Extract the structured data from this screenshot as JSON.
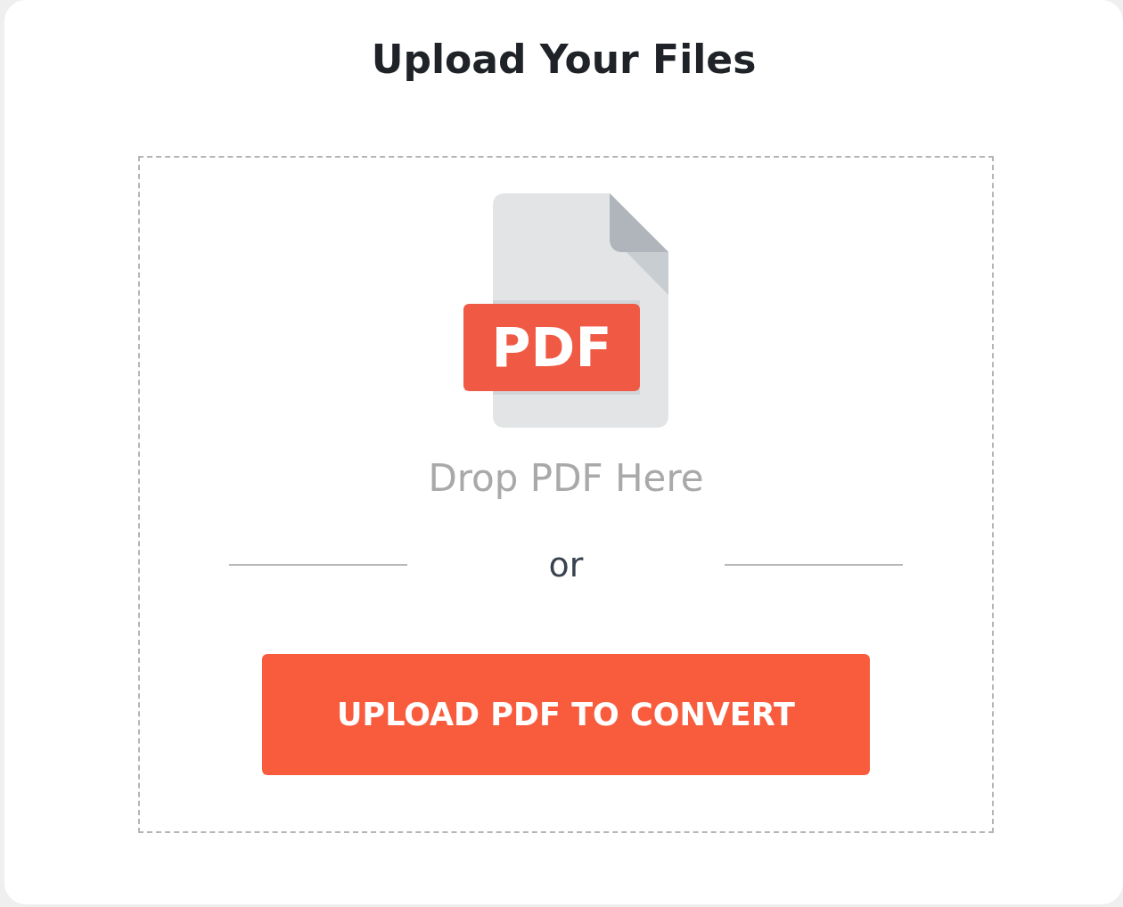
{
  "title": "Upload Your Files",
  "dropzone": {
    "file_label": "PDF",
    "hint": "Drop PDF Here",
    "separator": "or",
    "button": "UPLOAD PDF TO CONVERT"
  }
}
